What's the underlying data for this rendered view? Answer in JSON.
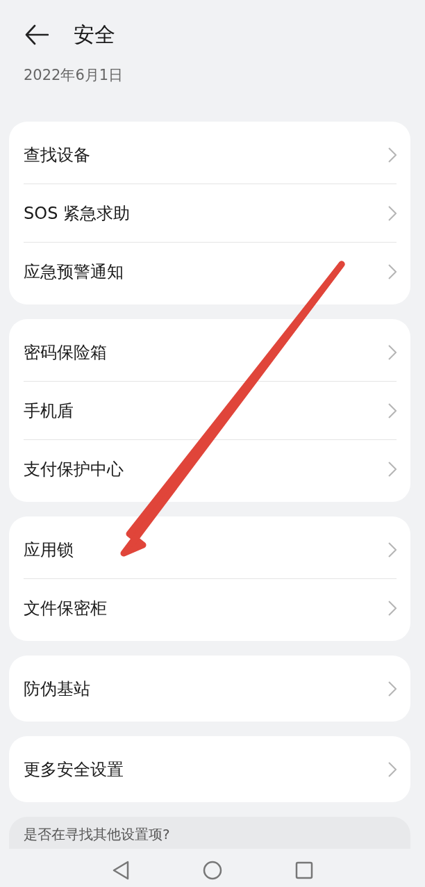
{
  "header": {
    "title": "安全",
    "date": "2022年6月1日"
  },
  "groups": [
    {
      "items": [
        "查找设备",
        "SOS 紧急求助",
        "应急预警通知"
      ]
    },
    {
      "items": [
        "密码保险箱",
        "手机盾",
        "支付保护中心"
      ]
    },
    {
      "items": [
        "应用锁",
        "文件保密柜"
      ]
    },
    {
      "items": [
        "防伪基站"
      ]
    },
    {
      "items": [
        "更多安全设置"
      ]
    }
  ],
  "suggestion": {
    "text": "是否在寻找其他设置项?"
  }
}
